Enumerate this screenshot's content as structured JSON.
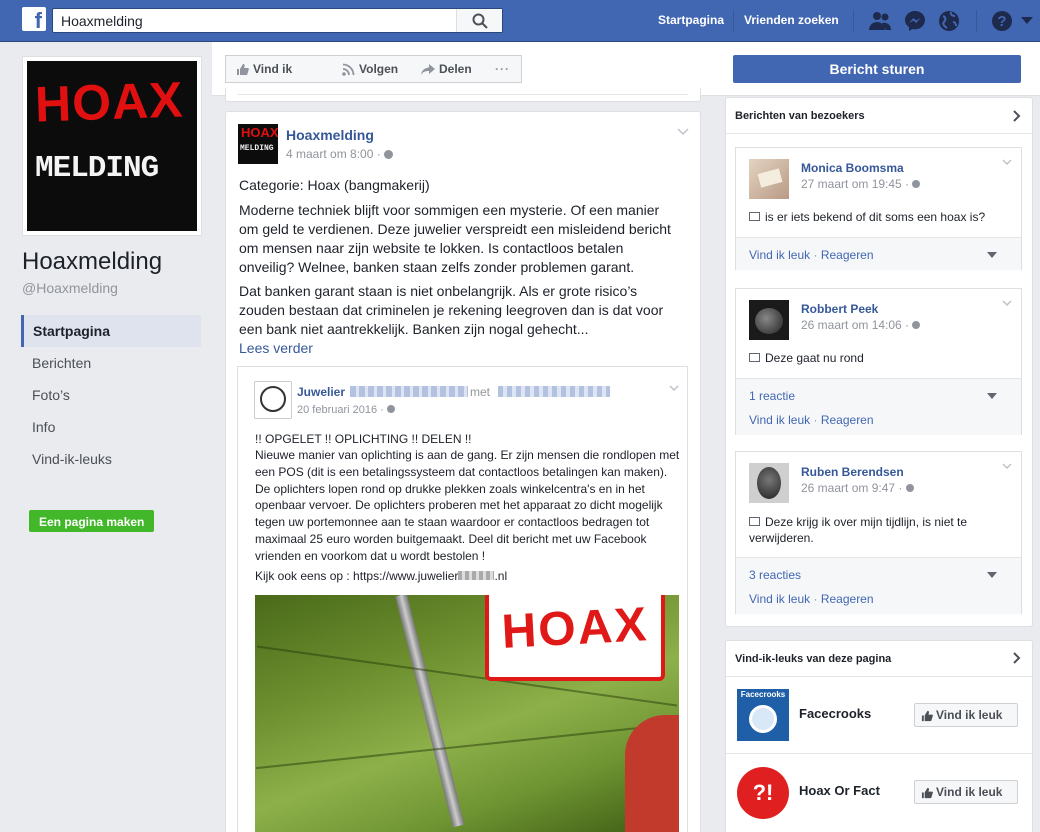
{
  "topbar": {
    "search_value": "Hoaxmelding",
    "nav_home": "Startpagina",
    "nav_friends": "Vrienden zoeken"
  },
  "left": {
    "page_name": "Hoaxmelding",
    "handle": "@Hoaxmelding",
    "nav": [
      "Startpagina",
      "Berichten",
      "Foto’s",
      "Info",
      "Vind-ik-leuks"
    ],
    "create_page": "Een pagina maken",
    "logo_line1": "HOAX",
    "logo_line2": "MELDING"
  },
  "actions": {
    "like": "Vind ik leuk",
    "follow": "Volgen",
    "share": "Delen",
    "more": "···",
    "send_message": "Bericht sturen"
  },
  "post": {
    "author": "Hoaxmelding",
    "time": "4 maart om 8:00 · ",
    "category": "Categorie: Hoax (bangmakerij)",
    "p1": "Moderne techniek blijft voor sommigen een mysterie. Of een manier om geld te verdienen. Deze juwelier verspreidt een misleidend bericht om mensen naar zijn website te lokken. Is contactloos betalen onveilig? Welnee, banken staan zelfs zonder problemen garant.",
    "p2": "Dat banken garant staan is niet onbelangrijk. Als er grote risico’s zouden bestaan dat criminelen je rekening leegroven dan is dat voor een bank niet aantrekkelijk. Banken zijn nogal gehecht...",
    "read_more": "Lees verder",
    "shared": {
      "author_visible": "Juwelier",
      "with_word": "met",
      "time": "20 februari 2016 · ",
      "headline": "!! OPGELET !! OPLICHTING !! DELEN !!",
      "body": "Nieuwe manier van oplichting is aan de gang. Er zijn mensen die rondlopen met een POS (dit is een betalingssysteem dat contactloos betalingen kan maken). De oplichters lopen rond op drukke plekken zoals winkelcentra's en in het openbaar vervoer. De oplichters proberen met het apparaat zo dicht mogelijk tegen uw portemonnee aan te staan waardoor er contactloos bedragen tot maximaal 25 euro worden buitgemaakt. Deel dit bericht met uw Facebook vrienden en voorkom dat u wordt bestolen !",
      "link_prefix": "Kijk ook eens op : https://www.juwelier",
      "link_suffix": ".nl",
      "stamp": "HOAX"
    }
  },
  "visitors": {
    "title": "Berichten van bezoekers",
    "items": [
      {
        "name": "Monica Boomsma",
        "time": "27 maart om 19:45 · ",
        "text": "is er iets bekend of dit soms een hoax is?",
        "like": "Vind ik leuk",
        "reply": "Reageren",
        "reactions": ""
      },
      {
        "name": "Robbert Peek",
        "time": "26 maart om 14:06 · ",
        "text": "Deze gaat nu rond",
        "like": "Vind ik leuk",
        "reply": "Reageren",
        "reactions": "1 reactie"
      },
      {
        "name": "Ruben Berendsen",
        "time": "26 maart om 9:47 · ",
        "text": "Deze krijg ik over mijn tijdlijn, is niet te verwijderen.",
        "like": "Vind ik leuk",
        "reply": "Reageren",
        "reactions": "3 reacties"
      }
    ]
  },
  "likes": {
    "title": "Vind-ik-leuks van deze pagina",
    "items": [
      {
        "name": "Facecrooks",
        "button": "Vind ik leuk",
        "logo_text": "Facecrooks"
      },
      {
        "name": "Hoax Or Fact",
        "button": "Vind ik leuk",
        "logo_text": "?!"
      }
    ]
  }
}
